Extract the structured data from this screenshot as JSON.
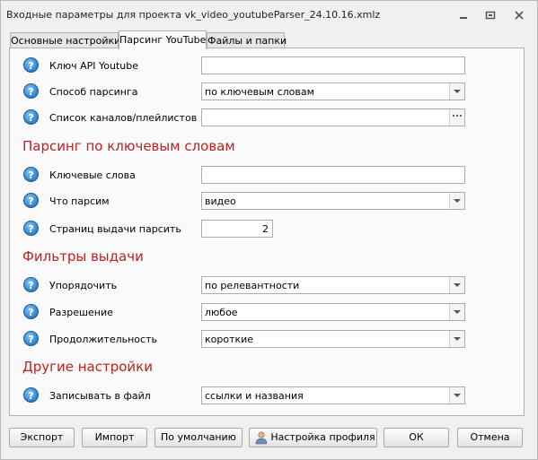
{
  "window": {
    "title": "Входные параметры для проекта vk_video_youtubeParser_24.10.16.xmlz"
  },
  "tabs": [
    {
      "label": "Основные настройки",
      "active": false
    },
    {
      "label": "Парсинг YouTube",
      "active": true
    },
    {
      "label": "Файлы и папки",
      "active": false
    }
  ],
  "fields": {
    "api_key": {
      "label": "Ключ API Youtube",
      "value": ""
    },
    "parse_method": {
      "label": "Способ парсинга",
      "value": "по ключевым словам"
    },
    "channels": {
      "label": "Список каналов/плейлистов",
      "value": ""
    }
  },
  "sections": {
    "keywords": "Парсинг по ключевым словам",
    "filters": "Фильтры выдачи",
    "other": "Другие настройки"
  },
  "keyword_fields": {
    "keywords": {
      "label": "Ключевые слова",
      "value": ""
    },
    "what": {
      "label": "Что парсим",
      "value": "видео"
    },
    "pages": {
      "label": "Страниц выдачи парсить",
      "value": "2"
    }
  },
  "filter_fields": {
    "order": {
      "label": "Упорядочить",
      "value": "по релевантности"
    },
    "resolution": {
      "label": "Разрешение",
      "value": "любое"
    },
    "duration": {
      "label": "Продолжительность",
      "value": "короткие"
    }
  },
  "other_fields": {
    "write_file": {
      "label": "Записывать в файл",
      "value": "ссылки и названия"
    }
  },
  "buttons": {
    "export": "Экспорт",
    "import": "Импорт",
    "defaults": "По умолчанию",
    "profile": "Настройка профиля",
    "ok": "ОК",
    "cancel": "Отмена"
  },
  "help_glyph": "?",
  "colors": {
    "section_title": "#c0201e",
    "help_icon": "#3a8fd6"
  }
}
